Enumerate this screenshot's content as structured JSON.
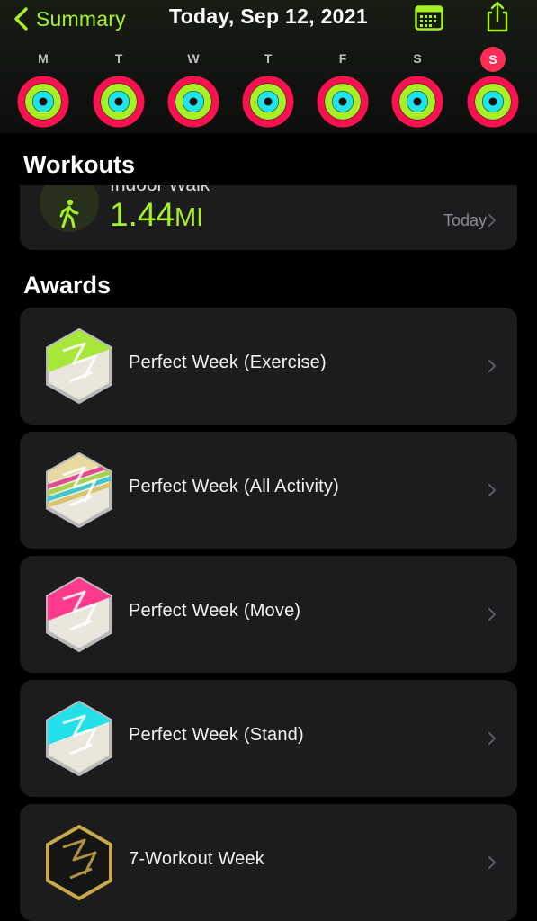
{
  "header": {
    "back_label": "Summary",
    "date_title": "Today, Sep 12, 2021",
    "icons": {
      "back": "chevron-left-icon",
      "calendar": "calendar-icon",
      "share": "share-icon"
    }
  },
  "week": [
    {
      "letter": "M",
      "today": false
    },
    {
      "letter": "T",
      "today": false
    },
    {
      "letter": "W",
      "today": false
    },
    {
      "letter": "T",
      "today": false
    },
    {
      "letter": "F",
      "today": false
    },
    {
      "letter": "S",
      "today": false
    },
    {
      "letter": "S",
      "today": true
    }
  ],
  "colors": {
    "accent": "#a8f026",
    "move": "#fa114f",
    "exercise": "#a8f026",
    "stand": "#1fe4ee",
    "today_badge": "#ff2d55",
    "card": "#1c1c1e"
  },
  "workouts": {
    "title": "Workouts",
    "item": {
      "name": "Indoor Walk",
      "value": "1.44",
      "unit": "MI",
      "date": "Today",
      "icon": "walking-figure-icon"
    }
  },
  "awards": {
    "title": "Awards",
    "items": [
      {
        "label": "Perfect Week (Exercise)",
        "badge": "perfect-week-exercise-badge-icon",
        "accent": "#a8e63a"
      },
      {
        "label": "Perfect Week (All Activity)",
        "badge": "perfect-week-all-activity-badge-icon",
        "accent": "#d8c36a"
      },
      {
        "label": "Perfect Week (Move)",
        "badge": "perfect-week-move-badge-icon",
        "accent": "#ff3a8d"
      },
      {
        "label": "Perfect Week (Stand)",
        "badge": "perfect-week-stand-badge-icon",
        "accent": "#23dfe8"
      },
      {
        "label": "7-Workout Week",
        "badge": "seven-workout-week-badge-icon",
        "accent": "#c9a84a"
      }
    ]
  }
}
